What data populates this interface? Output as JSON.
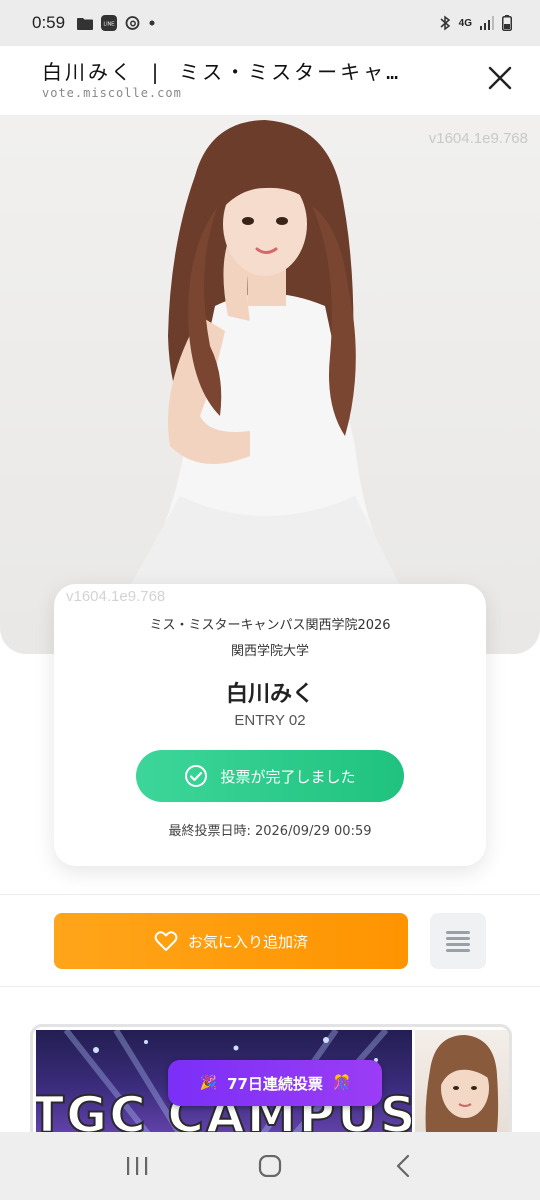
{
  "status_bar": {
    "time": "0:59",
    "network": "4G",
    "icons": [
      "folder-icon",
      "line-app-icon",
      "threads-icon",
      "dot-icon",
      "bluetooth-icon",
      "signal-icon",
      "battery-icon"
    ]
  },
  "header": {
    "title": "白川みく | ミス・ミスターキャ…",
    "url": "vote.miscolle.com",
    "close_icon": "close-icon"
  },
  "hero": {
    "watermark": "v1604.1e9.768"
  },
  "card": {
    "watermark": "v1604.1e9.768",
    "event": "ミス・ミスターキャンパス関西学院2026",
    "school": "関西学院大学",
    "name": "白川みく",
    "entry": "ENTRY 02",
    "vote_button_label": "投票が完了しました",
    "last_vote": "最終投票日時: 2026/09/29 00:59"
  },
  "actions": {
    "favorite_label": "お気に入り追加済",
    "menu_icon": "menu-icon"
  },
  "banner": {
    "badge_label": "77日連続投票",
    "background_text": "TGC CAMPUS"
  },
  "nav": {
    "icons": [
      "recent-apps-icon",
      "home-icon",
      "back-icon"
    ]
  },
  "colors": {
    "vote_green": "#2bcc8a",
    "favorite_orange": "#ff9d0a",
    "badge_purple": "#8a35f6"
  }
}
